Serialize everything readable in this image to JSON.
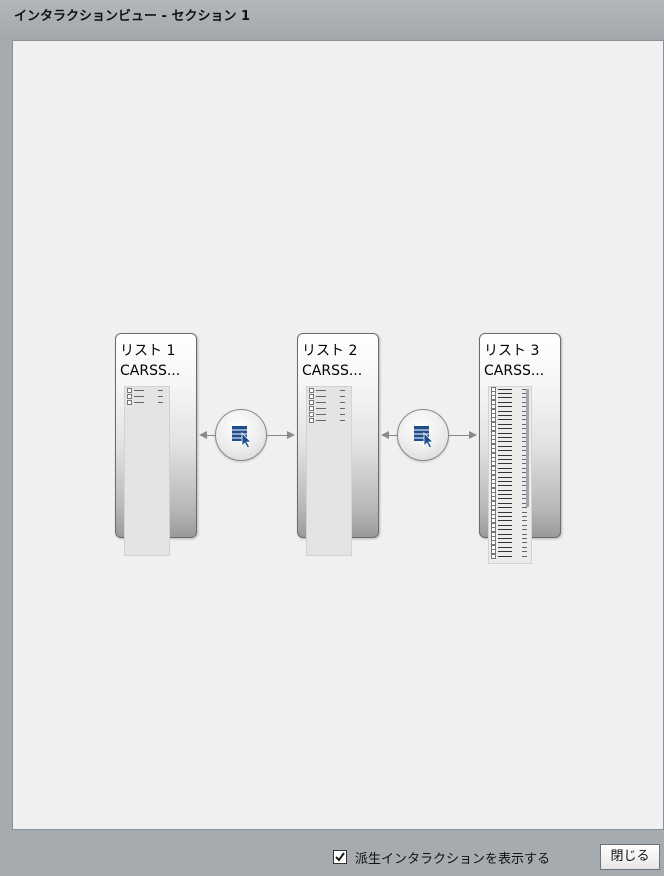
{
  "window": {
    "title": "インタラクションビュー - セクション 1"
  },
  "lists": [
    {
      "title": "リスト 1",
      "subtitle": "CARSS..."
    },
    {
      "title": "リスト 2",
      "subtitle": "CARSS..."
    },
    {
      "title": "リスト 3",
      "subtitle": "CARSS..."
    }
  ],
  "interactions": [
    {
      "icon": "interaction-select-icon"
    },
    {
      "icon": "interaction-select-icon"
    }
  ],
  "footer": {
    "show_derived_label": "派生インタラクションを表示する",
    "show_derived_checked": true,
    "close_label": "閉じる"
  },
  "colors": {
    "titlebar": "#a6abb0",
    "canvas": "#f0f0f0",
    "icon_blue": "#1f4e8c"
  }
}
